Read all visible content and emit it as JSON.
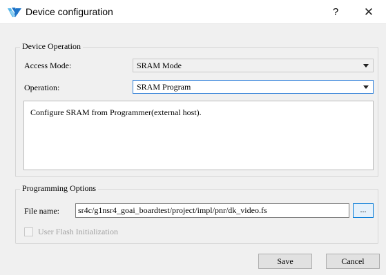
{
  "window": {
    "title": "Device configuration",
    "help_label": "?",
    "close_label": "✕"
  },
  "device_operation": {
    "legend": "Device Operation",
    "access_mode_label": "Access Mode:",
    "access_mode_value": "SRAM Mode",
    "operation_label": "Operation:",
    "operation_value": "SRAM Program",
    "description": "Configure SRAM from Programmer(external host)."
  },
  "programming_options": {
    "legend": "Programming Options",
    "file_name_label": "File name:",
    "file_name_value": "sr4c/g1nsr4_goai_boardtest/project/impl/pnr/dk_video.fs",
    "browse_label": "...",
    "user_flash_label": "User Flash Initialization",
    "user_flash_checked": false
  },
  "buttons": {
    "save": "Save",
    "cancel": "Cancel"
  },
  "colors": {
    "focus_border": "#2f7fd8",
    "browse_border": "#0078d7",
    "icon_blue": "#1e74c8",
    "icon_light": "#59b8ea"
  }
}
